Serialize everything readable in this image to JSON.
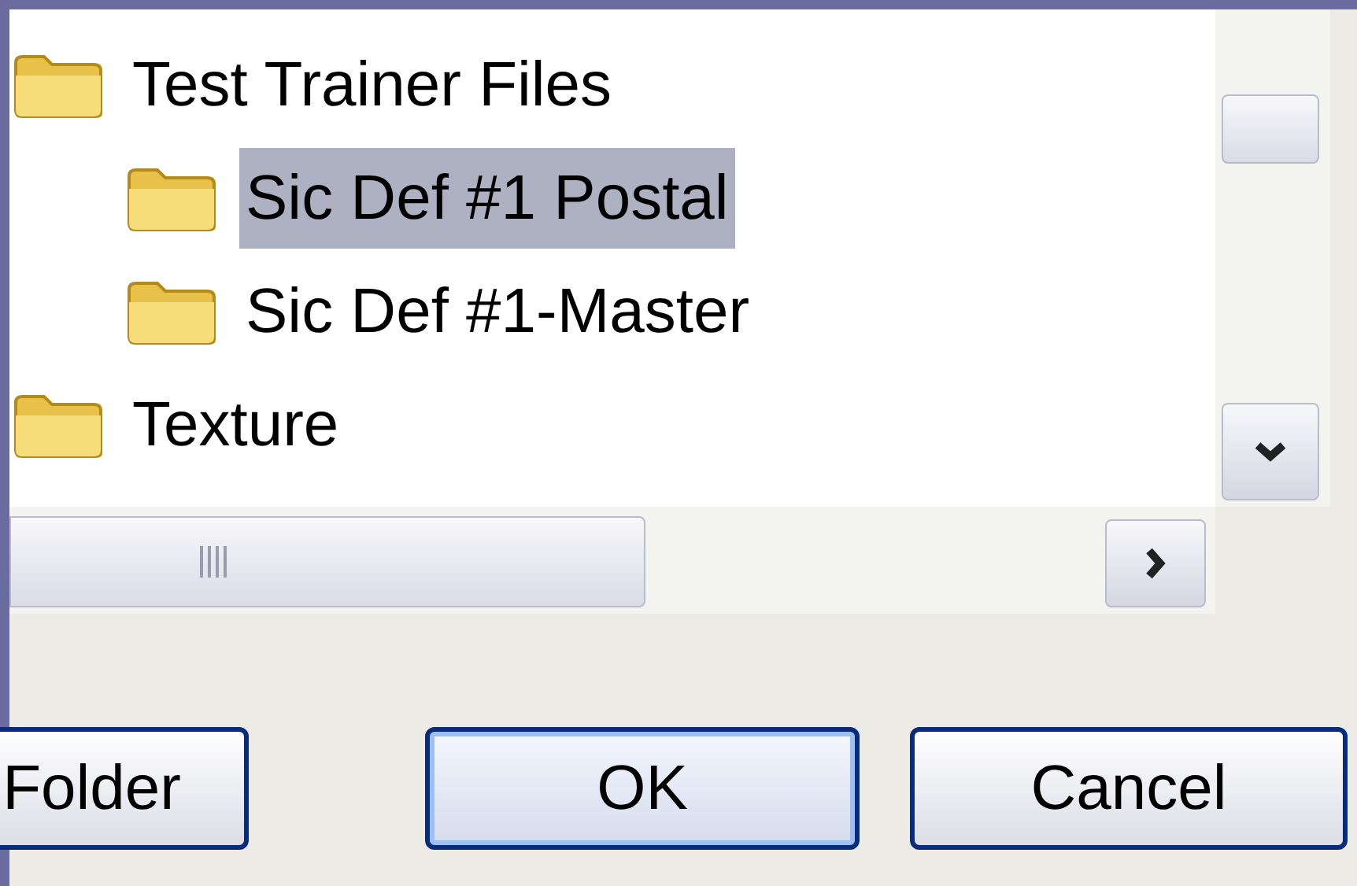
{
  "tree": [
    {
      "label": "Test Trainer Files",
      "selected": false,
      "children": [
        {
          "label": "Sic Def #1 Postal",
          "selected": true
        },
        {
          "label": "Sic Def #1-Master",
          "selected": false
        }
      ]
    },
    {
      "label": "Texture",
      "selected": false
    }
  ],
  "buttons": [
    {
      "label": "Folder",
      "focused": false
    },
    {
      "label": "OK",
      "focused": true
    },
    {
      "label": "Cancel",
      "focused": false
    }
  ]
}
